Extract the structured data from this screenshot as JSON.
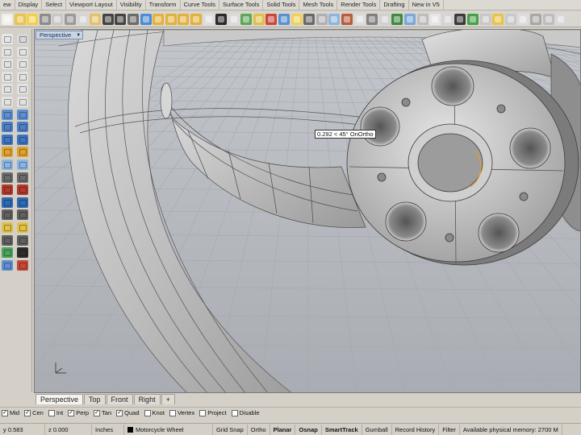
{
  "menu_tabs": [
    "ew",
    "Display",
    "Select",
    "Viewport Layout",
    "Visibility",
    "Transform",
    "Curve Tools",
    "Surface Tools",
    "Solid Tools",
    "Mesh Tools",
    "Render Tools",
    "Drafting",
    "New in V5"
  ],
  "toolbar_icons": [
    {
      "name": "new-file-icon",
      "color": "#f2efe8"
    },
    {
      "name": "open-folder-icon",
      "color": "#e8c34e"
    },
    {
      "name": "save-icon",
      "color": "#f4d04a"
    },
    {
      "name": "print-icon",
      "color": "#8c8c8c"
    },
    {
      "name": "import-icon",
      "color": "#c8c8c8"
    },
    {
      "name": "cut-icon",
      "color": "#9a9a9a"
    },
    {
      "name": "copy-icon",
      "color": "#d6d6d6"
    },
    {
      "name": "paste-icon",
      "color": "#e4c06a"
    },
    {
      "name": "undo-icon",
      "color": "#444444"
    },
    {
      "name": "redo-icon",
      "color": "#444444"
    },
    {
      "name": "pan-icon",
      "color": "#6b6b6b"
    },
    {
      "name": "rotate-view-icon",
      "color": "#4c8bd6"
    },
    {
      "name": "zoom-icon",
      "color": "#e2b23c"
    },
    {
      "name": "zoom-window-icon",
      "color": "#e2b23c"
    },
    {
      "name": "zoom-extents-icon",
      "color": "#e2b23c"
    },
    {
      "name": "zoom-selected-icon",
      "color": "#e2b23c"
    },
    {
      "name": "undo-view-icon",
      "color": "#dedede"
    },
    {
      "name": "four-viewports-icon",
      "color": "#2a2a2a"
    },
    {
      "name": "set-view-icon",
      "color": "#dadada"
    },
    {
      "name": "cplane-icon",
      "color": "#5fa55a"
    },
    {
      "name": "select-all-icon",
      "color": "#e0c048"
    },
    {
      "name": "layers-icon",
      "color": "#c8463a"
    },
    {
      "name": "object-properties-icon",
      "color": "#5a8fd2"
    },
    {
      "name": "lights-icon",
      "color": "#f0d05a"
    },
    {
      "name": "render-preview-icon",
      "color": "#6a6a6a"
    },
    {
      "name": "wireframe-icon",
      "color": "#b0b0b0"
    },
    {
      "name": "shaded-icon",
      "color": "#8fb4de"
    },
    {
      "name": "rendered-icon",
      "color": "#b95d3e"
    },
    {
      "name": "ghosted-icon",
      "color": "#dcdcdc"
    },
    {
      "name": "xray-icon",
      "color": "#808080"
    },
    {
      "name": "material-icon",
      "color": "#d0d0d0"
    },
    {
      "name": "render-icon",
      "color": "#3f8a3f"
    },
    {
      "name": "options-icon",
      "color": "#7aa8d8"
    },
    {
      "name": "help-icon",
      "color": "#bdbdbd"
    },
    {
      "name": "record-history-icon",
      "color": "#e5e5e5"
    },
    {
      "name": "matte-sphere-icon",
      "color": "#d4d4d4"
    },
    {
      "name": "environment-icon",
      "color": "#3a3a3a"
    },
    {
      "name": "ground-plane-icon",
      "color": "#46a04a"
    },
    {
      "name": "turntable-icon",
      "color": "#c8c8c8"
    },
    {
      "name": "sun-icon",
      "color": "#e8c446"
    },
    {
      "name": "texture-icon",
      "color": "#c9c9c9"
    },
    {
      "name": "decal-icon",
      "color": "#dcdcdc"
    },
    {
      "name": "capture-icon",
      "color": "#a8a8a8"
    },
    {
      "name": "settings-icon",
      "color": "#bdbdbd"
    },
    {
      "name": "info-icon",
      "color": "#d8d8d8"
    }
  ],
  "palette_icons": [
    {
      "name": "select-arrow-icon",
      "color": "#e6e6e6"
    },
    {
      "name": "point-icon",
      "color": "#d8d8d8"
    },
    {
      "name": "line-icon",
      "color": "#e2e2e2"
    },
    {
      "name": "polyline-icon",
      "color": "#e2e2e2"
    },
    {
      "name": "circle-icon",
      "color": "#e2e2e2"
    },
    {
      "name": "arc-icon",
      "color": "#e2e2e2"
    },
    {
      "name": "ellipse-icon",
      "color": "#e2e2e2"
    },
    {
      "name": "polygon-icon",
      "color": "#e2e2e2"
    },
    {
      "name": "curve-icon",
      "color": "#e2e2e2"
    },
    {
      "name": "freeform-icon",
      "color": "#e2e2e2"
    },
    {
      "name": "fillet-curve-icon",
      "color": "#e2e2e2"
    },
    {
      "name": "offset-curve-icon",
      "color": "#e2e2e2"
    },
    {
      "name": "plane-surface-icon",
      "color": "#5e8fd0"
    },
    {
      "name": "extrude-icon",
      "color": "#5e8fd0"
    },
    {
      "name": "loft-icon",
      "color": "#4f7fc3"
    },
    {
      "name": "sweep-icon",
      "color": "#4f7fc3"
    },
    {
      "name": "box-icon",
      "color": "#3f74c2"
    },
    {
      "name": "sphere-icon",
      "color": "#3f74c2"
    },
    {
      "name": "cylinder-icon",
      "color": "#e0a030"
    },
    {
      "name": "boolean-icon",
      "color": "#e0a030"
    },
    {
      "name": "mesh-icon",
      "color": "#8cb4e0"
    },
    {
      "name": "mesh-edit-icon",
      "color": "#8cb4e0"
    },
    {
      "name": "dimension-icon",
      "color": "#6a6a6a"
    },
    {
      "name": "text-icon",
      "color": "#6a6a6a"
    },
    {
      "name": "trim-icon",
      "color": "#b03a2e"
    },
    {
      "name": "split-icon",
      "color": "#b03a2e"
    },
    {
      "name": "join-icon",
      "color": "#2e6ab0"
    },
    {
      "name": "explode-icon",
      "color": "#2e6ab0"
    },
    {
      "name": "move-icon",
      "color": "#606060"
    },
    {
      "name": "copy-object-icon",
      "color": "#606060"
    },
    {
      "name": "rotate-icon",
      "color": "#e0c048"
    },
    {
      "name": "scale-icon",
      "color": "#e0c048"
    },
    {
      "name": "mirror-icon",
      "color": "#606060"
    },
    {
      "name": "array-icon",
      "color": "#606060"
    },
    {
      "name": "analyze-icon",
      "color": "#4aa35a"
    },
    {
      "name": "check-icon",
      "color": "#2d2d2d"
    },
    {
      "name": "grid-snap-icon",
      "color": "#5e8fd0"
    },
    {
      "name": "render-object-icon",
      "color": "#c24a3a"
    }
  ],
  "viewport": {
    "title": "Perspective",
    "tooltip": "0.292 < 45° OnOrtho",
    "background": "#b9bcc1"
  },
  "viewport_tabs": [
    "Perspective",
    "Top",
    "Front",
    "Right",
    "+"
  ],
  "osnap": [
    {
      "label": "Mid",
      "checked": true
    },
    {
      "label": "Cen",
      "checked": true
    },
    {
      "label": "Int",
      "checked": false
    },
    {
      "label": "Perp",
      "checked": true
    },
    {
      "label": "Tan",
      "checked": true
    },
    {
      "label": "Quad",
      "checked": true
    },
    {
      "label": "Knot",
      "checked": false
    },
    {
      "label": "Vertex",
      "checked": false
    },
    {
      "label": "Project",
      "checked": false
    },
    {
      "label": "Disable",
      "checked": false
    }
  ],
  "status": {
    "y": "y 0.583",
    "z": "z 0.000",
    "units": "Inches",
    "layer": "Motorcycle Wheel",
    "layer_color": "#000000",
    "grid_snap": "Grid Snap",
    "ortho": "Ortho",
    "planar": "Planar",
    "osnap": "Osnap",
    "smarttrack": "SmartTrack",
    "gumball": "Gumball",
    "record_history": "Record History",
    "filter": "Filter",
    "memory": "Available physical memory: 2700 M"
  }
}
